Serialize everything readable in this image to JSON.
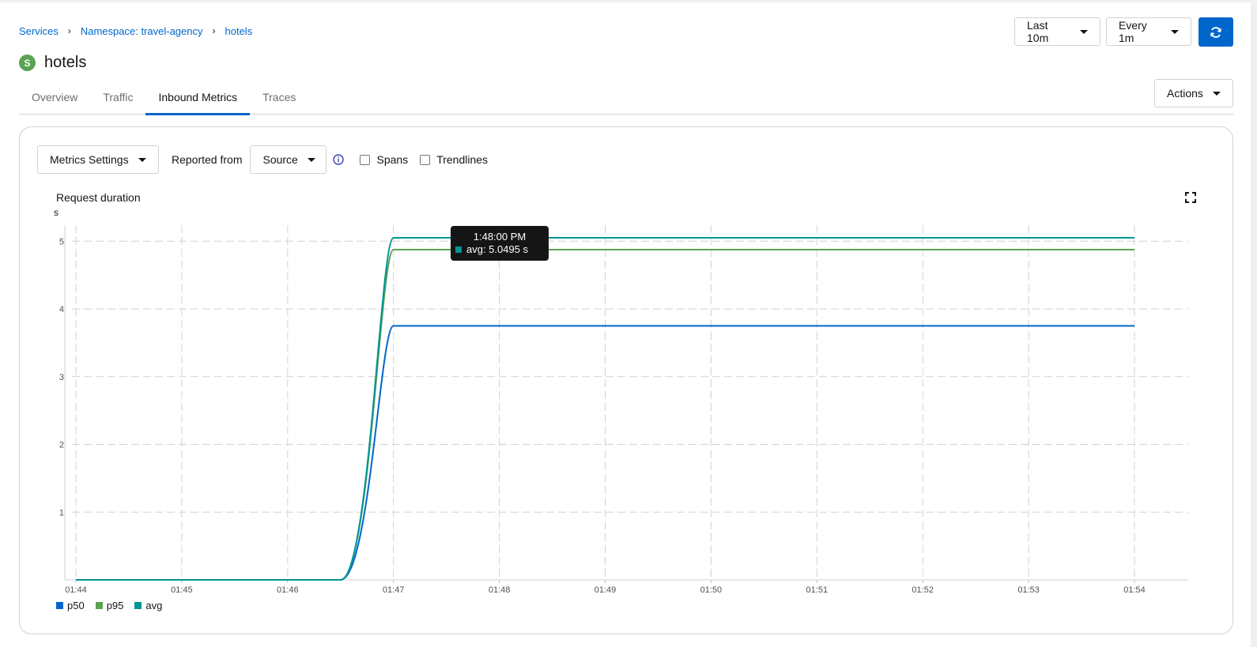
{
  "breadcrumb": {
    "items": [
      "Services",
      "Namespace: travel-agency",
      "hotels"
    ],
    "separator": "›"
  },
  "service": {
    "badge": "S",
    "name": "hotels"
  },
  "controls": {
    "time_range": "Last 10m",
    "refresh_interval": "Every 1m",
    "actions": "Actions"
  },
  "tabs": [
    {
      "label": "Overview",
      "active": false
    },
    {
      "label": "Traffic",
      "active": false
    },
    {
      "label": "Inbound Metrics",
      "active": true
    },
    {
      "label": "Traces",
      "active": false
    }
  ],
  "toolbar": {
    "metrics_settings": "Metrics Settings",
    "reported_from_label": "Reported from",
    "reported_from_value": "Source",
    "spans_label": "Spans",
    "trendlines_label": "Trendlines"
  },
  "tooltip": {
    "time": "1:48:00 PM",
    "text": "avg: 5.0495 s"
  },
  "chart_data": {
    "type": "line",
    "title": "Request duration",
    "ylabel": "s",
    "ylim": [
      0,
      5.4
    ],
    "yticks": [
      1,
      2,
      3,
      4,
      5
    ],
    "xticks": [
      "01:44",
      "01:45",
      "01:46",
      "01:47",
      "01:48",
      "01:49",
      "01:50",
      "01:51",
      "01:52",
      "01:53",
      "01:54"
    ],
    "x": [
      "01:44",
      "01:45",
      "01:46",
      "01:46:30",
      "01:47",
      "01:48",
      "01:49",
      "01:50",
      "01:51",
      "01:52",
      "01:53",
      "01:54"
    ],
    "series": [
      {
        "name": "p50",
        "color": "#06c",
        "values": [
          0,
          0,
          0,
          0,
          3.75,
          3.75,
          3.75,
          3.75,
          3.75,
          3.75,
          3.75,
          3.75
        ]
      },
      {
        "name": "p95",
        "color": "#5ba352",
        "values": [
          0,
          0,
          0,
          0,
          4.875,
          4.875,
          4.875,
          4.875,
          4.875,
          4.875,
          4.875,
          4.875
        ]
      },
      {
        "name": "avg",
        "color": "#009596",
        "values": [
          0,
          0,
          0,
          0,
          5.0495,
          5.0495,
          5.0495,
          5.0495,
          5.0495,
          5.0495,
          5.0495,
          5.0495
        ]
      }
    ],
    "grid": true,
    "legend": "bottom-left"
  }
}
